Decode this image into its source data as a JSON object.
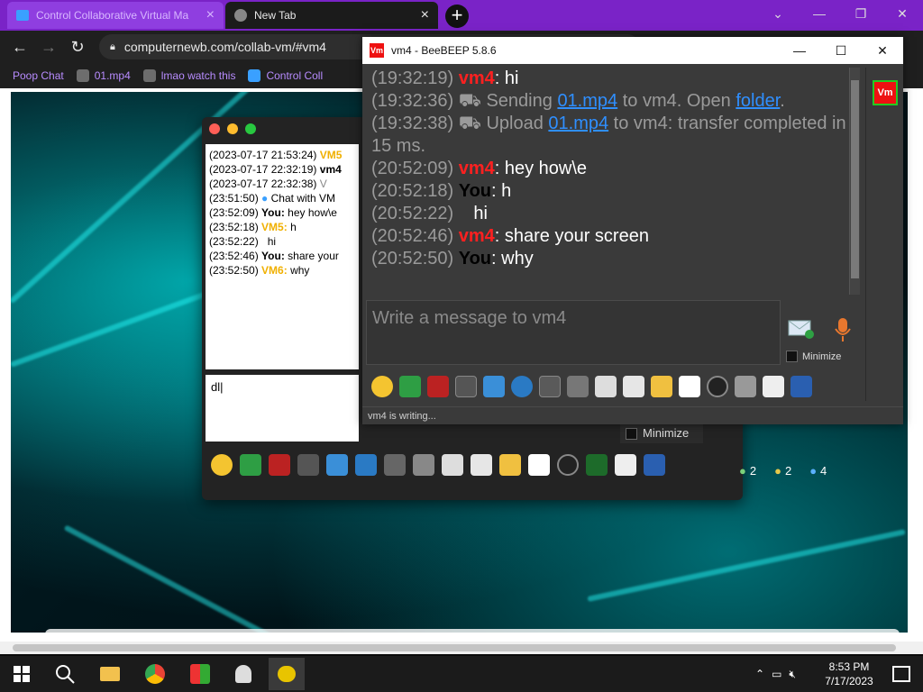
{
  "browser": {
    "tabs": [
      {
        "label": "Control Collaborative Virtual Ma"
      },
      {
        "label": "New Tab"
      }
    ],
    "url": "computernewb.com/collab-vm/#vm4",
    "bookmarks": [
      {
        "label": "Poop Chat"
      },
      {
        "label": "01.mp4"
      },
      {
        "label": "lmao watch this"
      },
      {
        "label": "Control Coll"
      }
    ]
  },
  "back_window": {
    "chat_lines": [
      {
        "ts": "(2023-07-17 21:53:24)",
        "who": "VM5",
        "text": ""
      },
      {
        "ts": "(2023-07-17 22:32:19)",
        "who": "vm4",
        "text": ""
      },
      {
        "ts": "(2023-07-17 22:32:38)",
        "who": "",
        "text": "V"
      },
      {
        "ts": "(23:51:50)",
        "who": "",
        "text": "Chat with VM"
      },
      {
        "ts": "(23:52:09)",
        "who": "You:",
        "text": "hey how\\e"
      },
      {
        "ts": "(23:52:18)",
        "who": "VM5:",
        "text": "h"
      },
      {
        "ts": "(23:52:22)",
        "who": "",
        "text": "hi"
      },
      {
        "ts": "(23:52:46)",
        "who": "You:",
        "text": "share your"
      },
      {
        "ts": "(23:52:50)",
        "who": "VM6:",
        "text": "why"
      }
    ],
    "input_value": "dl"
  },
  "main_window": {
    "title": "vm4 - BeeBEEP 5.8.6",
    "logo_text": "Vm",
    "messages": [
      {
        "ts": "(19:32:19)",
        "sender": "vm4",
        "kind": "vm",
        "text": ": hi"
      },
      {
        "ts": "(19:32:36)",
        "kind": "sys",
        "pre": "Sending ",
        "link1": "01.mp4",
        "mid": " to vm4. Open ",
        "link2": "folder",
        "post": "."
      },
      {
        "ts": "(19:32:38)",
        "kind": "sys2",
        "pre": "Upload ",
        "link1": "01.mp4",
        "post": " to vm4: transfer completed in 15 ms."
      },
      {
        "ts": "(20:52:09)",
        "sender": "vm4",
        "kind": "vm",
        "text": ": hey how\\e"
      },
      {
        "ts": "(20:52:18)",
        "sender": "You",
        "kind": "you",
        "text": ": h"
      },
      {
        "ts": "(20:52:22)",
        "kind": "plain",
        "text": "hi"
      },
      {
        "ts": "(20:52:46)",
        "sender": "vm4",
        "kind": "vm",
        "text": ": share your screen"
      },
      {
        "ts": "(20:52:50)",
        "sender": "You",
        "kind": "you",
        "text": ": why"
      }
    ],
    "input_placeholder": "Write a message to vm4",
    "minimize_label": "Minimize",
    "status_text": "vm4 is writing..."
  },
  "behind": {
    "minimize_label": "Minimize",
    "counters": [
      "2",
      "2",
      "4"
    ]
  },
  "taskbar": {
    "time": "8:53 PM",
    "date": "7/17/2023"
  }
}
